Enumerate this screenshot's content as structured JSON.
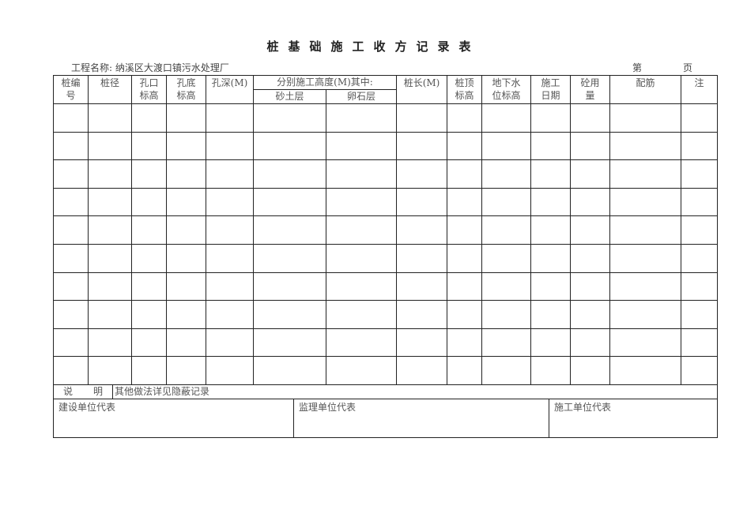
{
  "title": "桩基础施工收方记录表",
  "project_label": "工程名称:",
  "project_name": "纳溪区大渡口镇污水处理厂",
  "page": {
    "prefix": "第",
    "suffix": "页",
    "number": ""
  },
  "headers": {
    "pile_no": [
      "桩编",
      "号"
    ],
    "pile_dia": "桩径",
    "hole_top": [
      "孔口",
      "标高"
    ],
    "hole_bottom": [
      "孔底",
      "标高"
    ],
    "hole_depth": "孔深(M)",
    "layer_group": "分别施工高度(M)其中:",
    "sand_layer": "砂土层",
    "pebble_layer": "卵石层",
    "pile_length": "桩长(M)",
    "pile_top": [
      "桩顶",
      "标高"
    ],
    "groundwater": [
      "地下水",
      "位标高"
    ],
    "date": [
      "施工",
      "日期"
    ],
    "concrete": [
      "砼用",
      "量"
    ],
    "rebar": "配筋",
    "remark": "注"
  },
  "rows": [
    [
      "",
      "",
      "",
      "",
      "",
      "",
      "",
      "",
      "",
      "",
      "",
      "",
      "",
      ""
    ],
    [
      "",
      "",
      "",
      "",
      "",
      "",
      "",
      "",
      "",
      "",
      "",
      "",
      "",
      ""
    ],
    [
      "",
      "",
      "",
      "",
      "",
      "",
      "",
      "",
      "",
      "",
      "",
      "",
      "",
      ""
    ],
    [
      "",
      "",
      "",
      "",
      "",
      "",
      "",
      "",
      "",
      "",
      "",
      "",
      "",
      ""
    ],
    [
      "",
      "",
      "",
      "",
      "",
      "",
      "",
      "",
      "",
      "",
      "",
      "",
      "",
      ""
    ],
    [
      "",
      "",
      "",
      "",
      "",
      "",
      "",
      "",
      "",
      "",
      "",
      "",
      "",
      ""
    ],
    [
      "",
      "",
      "",
      "",
      "",
      "",
      "",
      "",
      "",
      "",
      "",
      "",
      "",
      ""
    ],
    [
      "",
      "",
      "",
      "",
      "",
      "",
      "",
      "",
      "",
      "",
      "",
      "",
      "",
      ""
    ],
    [
      "",
      "",
      "",
      "",
      "",
      "",
      "",
      "",
      "",
      "",
      "",
      "",
      "",
      ""
    ],
    [
      "",
      "",
      "",
      "",
      "",
      "",
      "",
      "",
      "",
      "",
      "",
      "",
      "",
      ""
    ]
  ],
  "notes": {
    "label_a": "说",
    "label_b": "明",
    "text": "其他做法详见隐蔽记录"
  },
  "signatures": {
    "owner": "建设单位代表",
    "supervisor": "监理单位代表",
    "contractor": "施工单位代表"
  }
}
